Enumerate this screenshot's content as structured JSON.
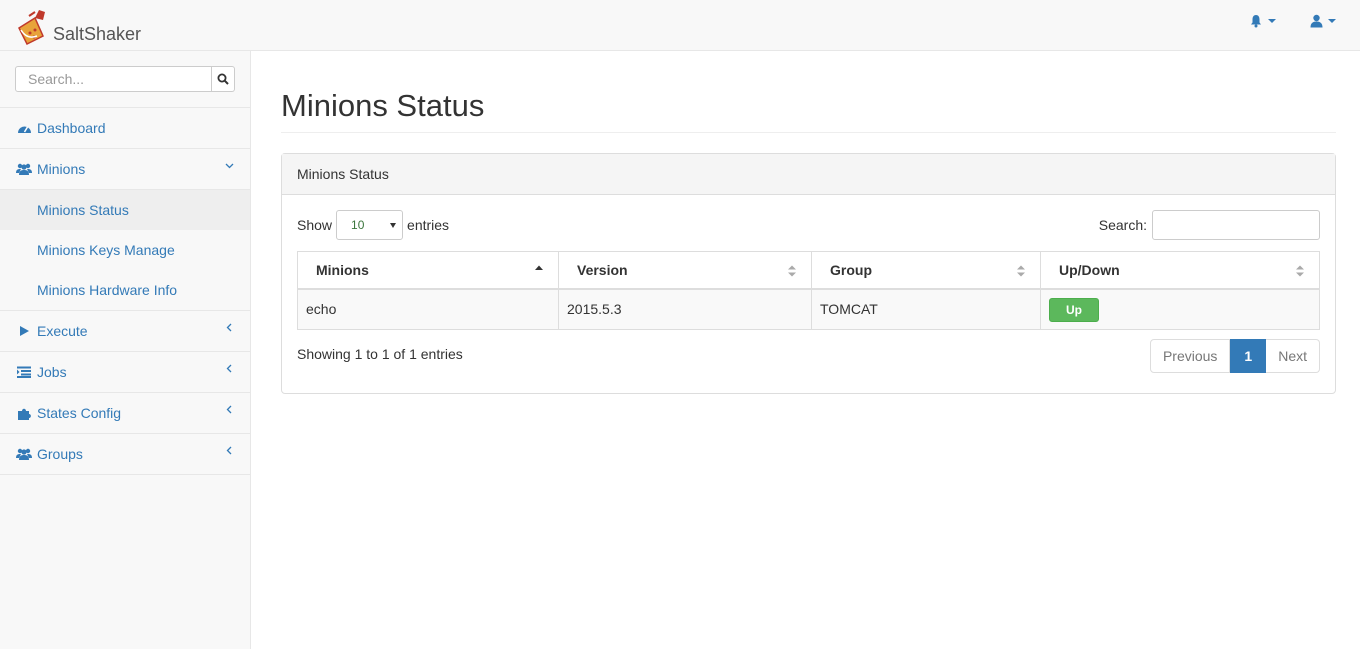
{
  "app": {
    "name": "SaltShaker"
  },
  "colors": {
    "link": "#337ab7",
    "success": "#5cb85c",
    "navbar_bg": "#f8f8f8"
  },
  "header": {
    "icons": [
      "bell-icon",
      "user-icon"
    ]
  },
  "sidebar": {
    "search": {
      "placeholder": "Search..."
    },
    "items": [
      {
        "label": "Dashboard",
        "icon": "dashboard-icon"
      },
      {
        "label": "Minions",
        "icon": "users-icon",
        "expanded": true,
        "children": [
          {
            "label": "Minions Status",
            "active": true
          },
          {
            "label": "Minions Keys Manage"
          },
          {
            "label": "Minions Hardware Info"
          }
        ]
      },
      {
        "label": "Execute",
        "icon": "play-icon"
      },
      {
        "label": "Jobs",
        "icon": "list-icon"
      },
      {
        "label": "States Config",
        "icon": "puzzle-icon"
      },
      {
        "label": "Groups",
        "icon": "users-icon"
      }
    ]
  },
  "main": {
    "title": "Minions Status",
    "panel": {
      "heading": "Minions Status",
      "length": {
        "prefix": "Show",
        "value": "10",
        "suffix": "entries"
      },
      "search_label": "Search:",
      "columns": [
        "Minions",
        "Version",
        "Group",
        "Up/Down"
      ],
      "rows": [
        {
          "minion": "echo",
          "version": "2015.5.3",
          "group": "TOMCAT",
          "status": "Up"
        }
      ],
      "info": "Showing 1 to 1 of 1 entries",
      "pagination": {
        "previous": "Previous",
        "current": "1",
        "next": "Next"
      }
    }
  }
}
